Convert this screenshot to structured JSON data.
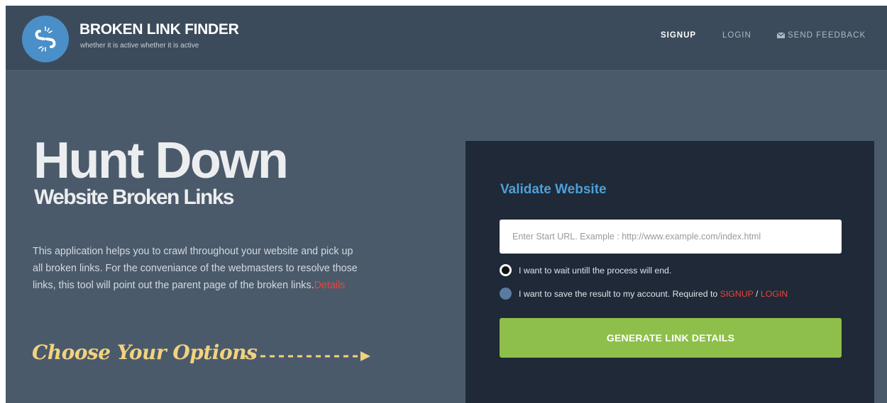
{
  "header": {
    "brand": "BROKEN LINK FINDER",
    "tagline": "whether it is active  whether it is active",
    "nav": {
      "signup": "SIGNUP",
      "login": "LOGIN",
      "feedback": "SEND FEEDBACK",
      "feedback_icon": "mail-icon"
    }
  },
  "hero": {
    "title": "Hunt Down",
    "subtitle": "Website Broken Links",
    "description": "This application helps you to crawl throughout your website and pick up all broken links. For the conveniance of the webmasters to resolve those links, this tool will point out the parent page of the broken links.",
    "details_link": "Details",
    "choose": "Choose Your Options"
  },
  "panel": {
    "title": "Validate Website",
    "url_placeholder": "Enter Start URL. Example : http://www.example.com/index.html",
    "url_value": "",
    "option_wait": "I want to wait untill the process will end.",
    "option_save": "I want to save the result to my account. Required to",
    "signup_link": "SIGNUP",
    "separator": " / ",
    "login_link": "LOGIN",
    "generate_button": "GENERATE LINK DETAILS",
    "selected_option": "wait"
  },
  "colors": {
    "background": "#4a5a6b",
    "header": "#3c4b5b",
    "panel": "#1f2937",
    "accent_blue": "#4e9fd9",
    "accent_red": "#e8453c",
    "button_green": "#8ebf4a",
    "choose_yellow": "#f2d27e"
  }
}
